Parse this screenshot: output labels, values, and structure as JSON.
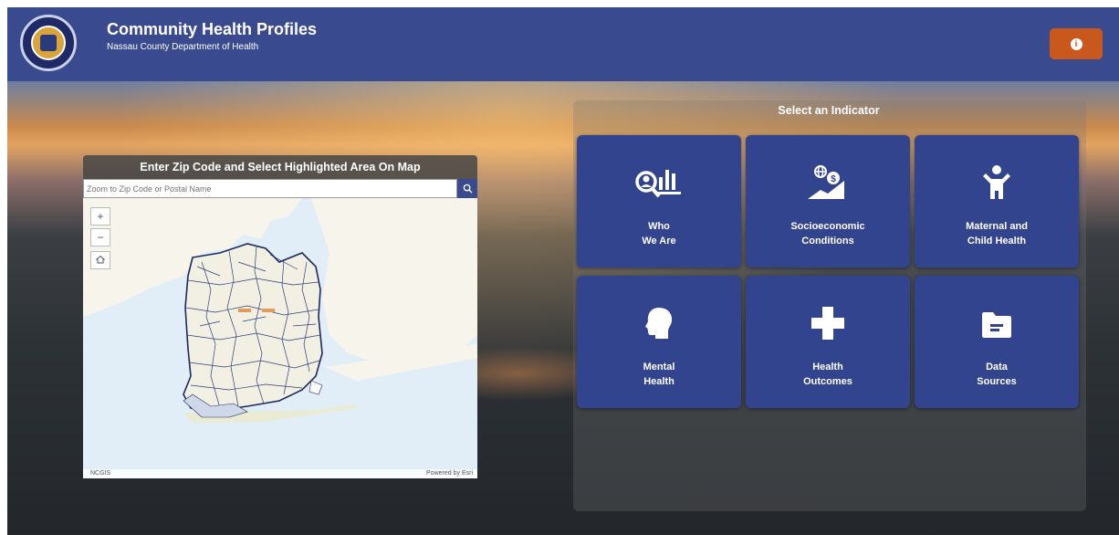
{
  "header": {
    "title": "Community Health Profiles",
    "subtitle": "Nassau County Department of Health",
    "info_icon": "info-icon"
  },
  "map_panel": {
    "heading": "Enter Zip Code and Select Highlighted Area On Map",
    "search_placeholder": "Zoom to Zip Code or Postal Name",
    "zoom_in": "+",
    "zoom_out": "−",
    "attribution_left": "NCGIS",
    "attribution_right": "Powered by Esri"
  },
  "indicators": {
    "title": "Select an Indicator",
    "tiles": [
      {
        "line1": "Who",
        "line2": "We Are",
        "icon": "demographics-icon"
      },
      {
        "line1": "Socioeconomic",
        "line2": "Conditions",
        "icon": "economy-icon"
      },
      {
        "line1": "Maternal and",
        "line2": "Child Health",
        "icon": "child-icon"
      },
      {
        "line1": "Mental",
        "line2": "Health",
        "icon": "head-icon"
      },
      {
        "line1": "Health",
        "line2": "Outcomes",
        "icon": "medical-cross-icon"
      },
      {
        "line1": "Data",
        "line2": "Sources",
        "icon": "folder-icon"
      }
    ]
  },
  "colors": {
    "header_bg": "#3a4a8f",
    "tile_bg": "#33448e",
    "info_button": "#c8581c"
  }
}
